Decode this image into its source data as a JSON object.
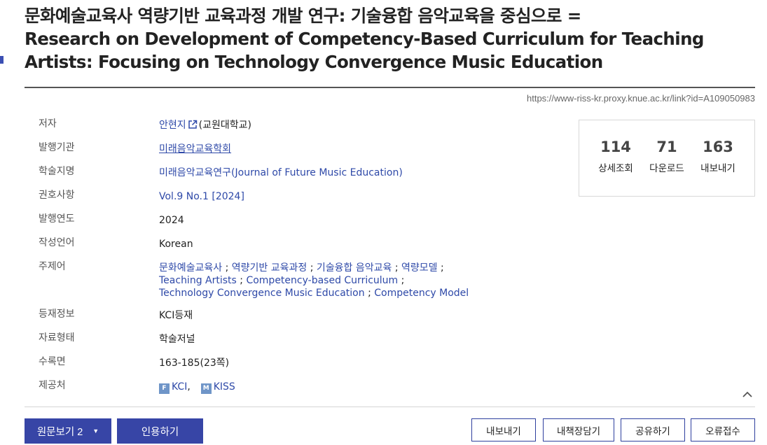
{
  "title": {
    "line1": "문화예술교육사 역량기반 교육과정 개발 연구: 기술융합 음악교육을 중심으로 =",
    "line2": "Research on Development of Competency-Based Curriculum for Teaching",
    "line3": "Artists: Focusing on Technology Convergence Music Education"
  },
  "link_url": "https://www-riss-kr.proxy.knue.ac.kr/link?id=A109050983",
  "meta": {
    "author": {
      "label": "저자",
      "name": "안현지",
      "affiliation": "(교원대학교)"
    },
    "publisher": {
      "label": "발행기관",
      "value": "미래음악교육학회"
    },
    "journal": {
      "label": "학술지명",
      "value": "미래음악교육연구(Journal of Future Music Education)"
    },
    "issue": {
      "label": "권호사항",
      "value": "Vol.9 No.1 [2024]"
    },
    "year": {
      "label": "발행연도",
      "value": "2024"
    },
    "language": {
      "label": "작성언어",
      "value": "Korean"
    },
    "subjects": {
      "label": "주제어",
      "items": [
        "문화예술교육사",
        "역량기반 교육과정",
        "기술융합 음악교육",
        "역량모델",
        "Teaching Artists",
        "Competency-based Curriculum",
        "Technology Convergence Music Education",
        "Competency Model"
      ]
    },
    "registration": {
      "label": "등재정보",
      "value": "KCI등재"
    },
    "material_type": {
      "label": "자료형태",
      "value": "학술저널"
    },
    "pages": {
      "label": "수록면",
      "value": "163-185(23쪽)"
    },
    "provider": {
      "label": "제공처",
      "items": [
        {
          "badge": "F",
          "name": "KCI",
          "suffix": ","
        },
        {
          "badge": "M",
          "name": "KISS",
          "suffix": ""
        }
      ]
    }
  },
  "stats": [
    {
      "value": "114",
      "label": "상세조회"
    },
    {
      "value": "71",
      "label": "다운로드"
    },
    {
      "value": "163",
      "label": "내보내기"
    }
  ],
  "buttons": {
    "view_original": "원문보기 2",
    "cite": "인용하기",
    "export": "내보내기",
    "bookshelf": "내책장담기",
    "share": "공유하기",
    "report_error": "오류접수"
  },
  "icons": {
    "external_link": "external-link-icon",
    "collapse": "chevron-up-icon",
    "dropdown": "caret-down-icon"
  },
  "colors": {
    "primary": "#3745a6",
    "link": "#2e49a8",
    "badge": "#6f95c8"
  }
}
